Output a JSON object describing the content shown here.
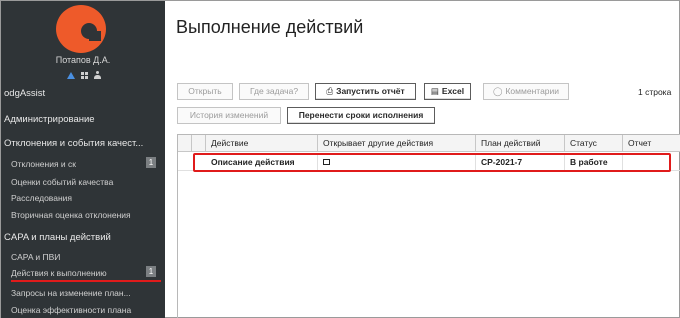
{
  "sidebar": {
    "user_name": "Потапов Д.А.",
    "user_icons": [
      "warning-icon",
      "grid-icon",
      "user-icon"
    ],
    "items": [
      {
        "label": "odgAssist",
        "level": "top"
      },
      {
        "label": "Администрирование",
        "level": "top"
      },
      {
        "label": "Отклонения и события качест...",
        "level": "top"
      },
      {
        "label": "Отклонения и ск",
        "level": "sub",
        "badge": "1"
      },
      {
        "label": "Оценки событий качества",
        "level": "sub"
      },
      {
        "label": "Расследования",
        "level": "sub"
      },
      {
        "label": "Вторичная оценка отклонения",
        "level": "sub"
      },
      {
        "label": "CAPA и планы действий",
        "level": "top"
      },
      {
        "label": "CAPA и ПВИ",
        "level": "sub"
      },
      {
        "label": "Действия к выполнению",
        "level": "sub",
        "badge": "1",
        "active": true
      },
      {
        "label": "Запросы на изменение план...",
        "level": "sub"
      },
      {
        "label": "Оценка эффективности плана",
        "level": "sub"
      }
    ]
  },
  "main": {
    "title": "Выполнение действий",
    "toolbar": {
      "open": "Открыть",
      "where_task": "Где задача?",
      "run_report": "Запустить отчёт",
      "excel": "Excel",
      "comments": "Комментарии",
      "history": "История изменений",
      "postpone": "Перенести сроки исполнения"
    },
    "row_count": "1 строка",
    "table": {
      "headers": [
        "Действие",
        "Открывает другие действия",
        "План действий",
        "Статус",
        "Отчет"
      ],
      "rows": [
        {
          "action": "Описание действия",
          "opens_other": false,
          "plan": "CP-2021-7",
          "status": "В работе",
          "report": ""
        }
      ]
    }
  },
  "colors": {
    "sidebar_bg": "#2f3437",
    "logo": "#ee5a2a",
    "highlight": "#e01b1b"
  }
}
